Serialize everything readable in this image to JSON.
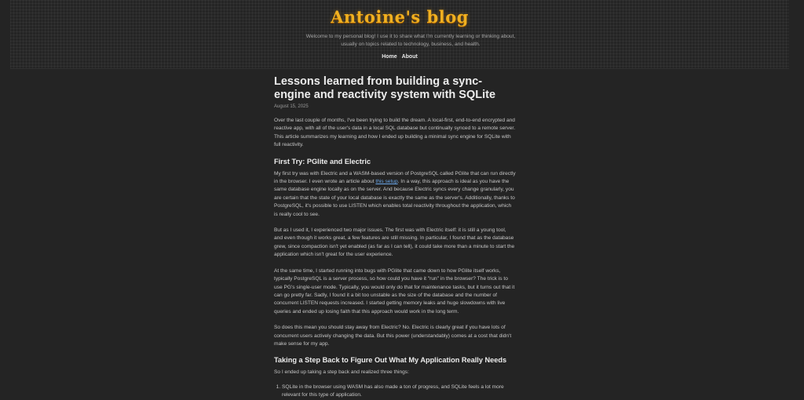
{
  "site": {
    "logo": "Antoine's blog",
    "tagline": "Welcome to my personal blog! I use it to share what I'm currently learning or thinking about, usually on topics related to technology, business, and health.",
    "nav": [
      "Home",
      "About"
    ]
  },
  "article": {
    "title": "Lessons learned from building a sync-engine and reactivity system with SQLite",
    "date": "August 15, 2025",
    "intro": "Over the last couple of months, I've been trying to build the dream. A local-first, end-to-end encrypted and reactive app, with all of the user's data in a local SQL database but continually synced to a remote server. This article summarizes my learning and how I ended up building a minimal sync engine for SQLite with full reactivity.",
    "section1_title": "First Try: PGlite and Electric",
    "p1_before_link": "My first try was with Electric and a WASM-based version of PostgreSQL called PGlite that can run directly in the browser. I even wrote an article about ",
    "p1_link": "this setup",
    "p1_after_link": ". In a way, this approach is ideal as you have the same database engine locally as on the server. And because Electric syncs every change granularly, you are certain that the state of your local database is exactly the same as the server's. Additionally, thanks to PostgreSQL, it's possible to use LISTEN which enables total reactivity throughout the application, which is really cool to see.",
    "p2": "But as I used it, I experienced two major issues. The first was with Electric itself: it is still a young tool, and even though it works great, a few features are still missing. In particular, I found that as the database grew, since compaction isn't yet enabled (as far as I can tell), it could take more than a minute to start the application which isn't great for the user experience.",
    "p3": "At the same time, I started running into bugs with PGlite that came down to how PGlite itself works, typically PostgreSQL is a server process, so how could you have it \"run\" in the browser? The trick is to use PG's single-user mode. Typically, you would only do that for maintenance tasks, but it turns out that it can go pretty far. Sadly, I found it a bit too unstable as the size of the database and the number of concurrent LISTEN requests increased. I started getting memory leaks and huge slowdowns with live queries and ended up losing faith that this approach would work in the long term.",
    "p4": "So does this mean you should stay away from Electric? No. Electric is clearly great if you have lots of concurrent users actively changing the data. But this power (understandably) comes at a cost that didn't make sense for my app.",
    "section2_title": "Taking a Step Back to Figure Out What My Application Really Needs",
    "p5": "So I ended up taking a step back and realized three things:",
    "list1": "SQLite in the browser using WASM has also made a ton of progress, and SQLite feels a lot more relevant for this type of application."
  },
  "colors": {
    "background": "#242424",
    "logo": "#f0b020",
    "link": "#6aa6e8"
  }
}
